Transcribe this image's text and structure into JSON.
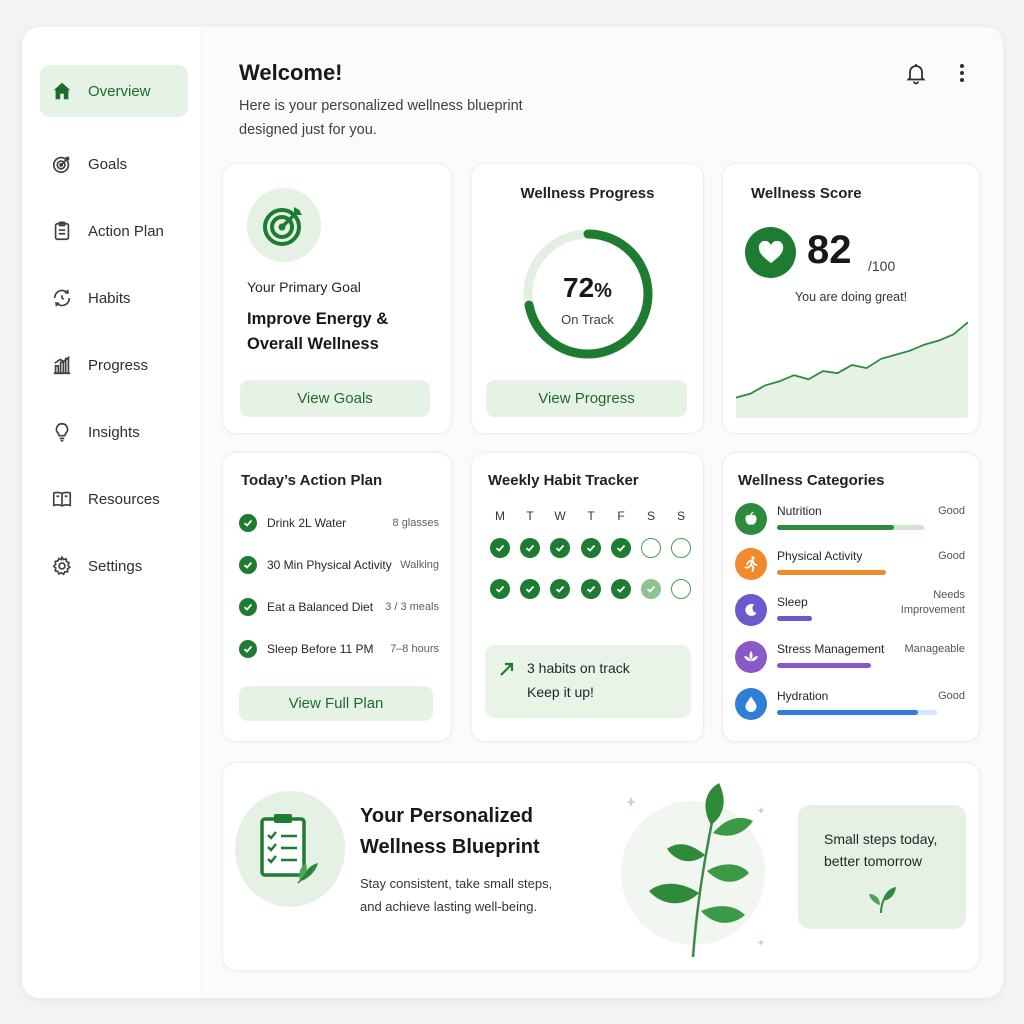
{
  "sidebar": {
    "items": [
      {
        "label": "Overview",
        "icon": "home-icon",
        "active": true
      },
      {
        "label": "Goals",
        "icon": "target-icon"
      },
      {
        "label": "Action Plan",
        "icon": "clipboard-icon"
      },
      {
        "label": "Habits",
        "icon": "cycle-icon"
      },
      {
        "label": "Progress",
        "icon": "bar-chart-icon"
      },
      {
        "label": "Insights",
        "icon": "lightbulb-icon"
      },
      {
        "label": "Resources",
        "icon": "book-icon"
      },
      {
        "label": "Settings",
        "icon": "gear-icon"
      }
    ]
  },
  "header": {
    "title": "Welcome!",
    "subtitle": "Here is your personalized wellness blueprint designed just for you.",
    "icons": [
      "bell-icon",
      "more-vertical-icon"
    ]
  },
  "goal_card": {
    "label": "Your Primary Goal",
    "goal": "Improve Energy & Overall Wellness",
    "button": "View Goals"
  },
  "progress_card": {
    "title": "Wellness Progress",
    "value": "72",
    "unit": "%",
    "percent": 72,
    "status": "On Track",
    "button": "View Progress"
  },
  "score_card": {
    "title": "Wellness Score",
    "score": "82",
    "max": "/100",
    "message": "You are doing great!",
    "trend": [
      18,
      22,
      30,
      34,
      40,
      36,
      44,
      42,
      50,
      47,
      56,
      60,
      64,
      70,
      74,
      80,
      92
    ]
  },
  "action_plan": {
    "title": "Today’s Action Plan",
    "items": [
      {
        "label": "Drink 2L Water",
        "value": "8 glasses"
      },
      {
        "label": "30 Min Physical Activity",
        "value": "Walking"
      },
      {
        "label": "Eat a Balanced Diet",
        "value": "3 / 3 meals"
      },
      {
        "label": "Sleep Before 11 PM",
        "value": "7–8 hours"
      }
    ],
    "button": "View Full Plan"
  },
  "habit_tracker": {
    "title": "Weekly Habit Tracker",
    "days": [
      "M",
      "T",
      "W",
      "T",
      "F",
      "S",
      "S"
    ],
    "rows": [
      [
        "done",
        "done",
        "done",
        "done",
        "done",
        "empty",
        "empty"
      ],
      [
        "done",
        "done",
        "done",
        "done",
        "done",
        "partial",
        "empty"
      ]
    ],
    "summary_line1": "3 habits on track",
    "summary_line2": "Keep it up!"
  },
  "categories": {
    "title": "Wellness Categories",
    "items": [
      {
        "name": "Nutrition",
        "status": "Good",
        "level": 0.62,
        "track_level": 0.78,
        "color": "#2e8b3e",
        "track": "#cfe6cc",
        "icon": "apple-icon",
        "icon_bg": "#2e8b3e"
      },
      {
        "name": "Physical Activity",
        "status": "Good",
        "level": 0.58,
        "track_level": 0.58,
        "color": "#f08a2c",
        "track": "#fbe3cc",
        "icon": "running-icon",
        "icon_bg": "#f08a2c"
      },
      {
        "name": "Sleep",
        "status": "Needs Improvement",
        "level": 0.42,
        "track_level": 0.42,
        "color": "#6a5acd",
        "track": "#e6e2f6",
        "icon": "moon-icon",
        "icon_bg": "#6a5acd"
      },
      {
        "name": "Stress Management",
        "status": "Manageable",
        "level": 0.5,
        "track_level": 0.5,
        "color": "#8a58c8",
        "track": "#ece2f6",
        "icon": "lotus-icon",
        "icon_bg": "#8a58c8"
      },
      {
        "name": "Hydration",
        "status": "Good",
        "level": 0.75,
        "track_level": 0.85,
        "color": "#2f7fd6",
        "track": "#d4e6fa",
        "icon": "water-drop-icon",
        "icon_bg": "#2f7fd6"
      }
    ]
  },
  "banner": {
    "title_line1": "Your Personalized",
    "title_line2": "Wellness Blueprint",
    "text_line1": "Stay consistent, take small steps,",
    "text_line2": "and achieve lasting well-being.",
    "quote_line1": "Small steps today,",
    "quote_line2": "better tomorrow"
  },
  "colors": {
    "accent": "#1e7b32",
    "accent_light": "#e6f2e6"
  }
}
